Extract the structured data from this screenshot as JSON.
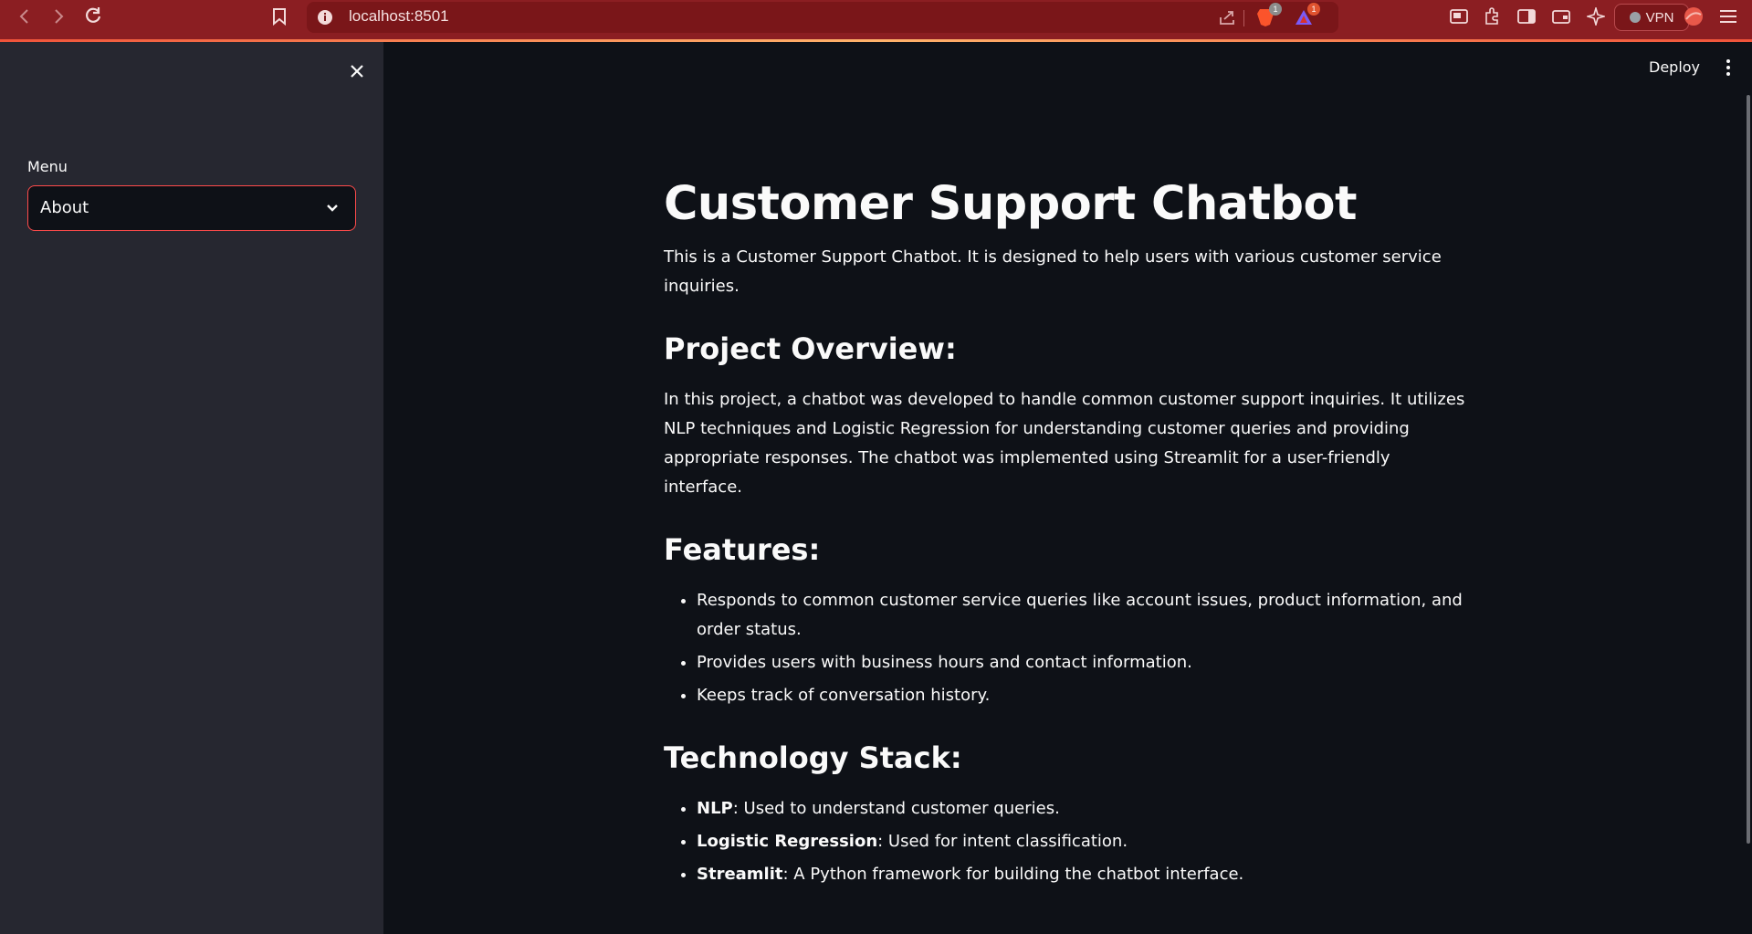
{
  "browser": {
    "url": "localhost:8501",
    "badges": {
      "brave": "1",
      "rewards": "1"
    },
    "vpn_label": "VPN"
  },
  "sidebar": {
    "menu_label": "Menu",
    "select_value": "About"
  },
  "header": {
    "deploy_label": "Deploy"
  },
  "content": {
    "title": "Customer Support Chatbot",
    "intro": "This is a Customer Support Chatbot. It is designed to help users with various customer service inquiries.",
    "overview_heading": "Project Overview:",
    "overview_text": "In this project, a chatbot was developed to handle common customer support inquiries. It utilizes NLP techniques and Logistic Regression for understanding customer queries and providing appropriate responses. The chatbot was implemented using Streamlit for a user-friendly interface.",
    "features_heading": "Features:",
    "features": [
      "Responds to common customer service queries like account issues, product information, and order status.",
      "Provides users with business hours and contact information.",
      "Keeps track of conversation history."
    ],
    "tech_heading": "Technology Stack:",
    "tech": [
      {
        "name": "NLP",
        "desc": ": Used to understand customer queries."
      },
      {
        "name": "Logistic Regression",
        "desc": ": Used for intent classification."
      },
      {
        "name": "Streamlit",
        "desc": ": A Python framework for building the chatbot interface."
      }
    ]
  },
  "colors": {
    "browser_bar": "#8b1e22",
    "sidebar_bg": "#262730",
    "main_bg": "#0e1117",
    "accent": "#ff4b4b"
  },
  "icons": [
    "back-icon",
    "forward-icon",
    "reload-icon",
    "bookmark-icon",
    "info-icon",
    "share-icon",
    "brave-icon",
    "rewards-icon",
    "pip-icon",
    "extensions-icon",
    "sidebar-icon",
    "wallet-icon",
    "leo-icon",
    "profile-icon",
    "hamburger-icon",
    "close-icon",
    "chevron-down-icon",
    "kebab-menu-icon"
  ]
}
